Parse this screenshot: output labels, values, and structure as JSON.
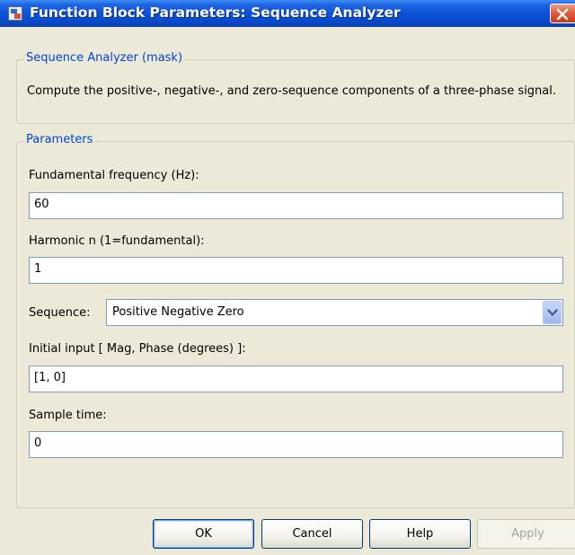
{
  "window": {
    "title": "Function Block Parameters: Sequence Analyzer"
  },
  "mask_group": {
    "legend": "Sequence Analyzer (mask)",
    "description": "Compute the positive-, negative-, and zero-sequence components of a three-phase signal."
  },
  "params_group": {
    "legend": "Parameters",
    "fundamental_frequency": {
      "label": "Fundamental frequency (Hz):",
      "value": "60"
    },
    "harmonic": {
      "label": "Harmonic n (1=fundamental):",
      "value": "1"
    },
    "sequence": {
      "label": "Sequence:",
      "selected": "Positive Negative Zero"
    },
    "initial_input": {
      "label": "Initial input [ Mag, Phase (degrees) ]:",
      "value": "[1, 0]"
    },
    "sample_time": {
      "label": "Sample time:",
      "value": "0"
    }
  },
  "buttons": {
    "ok": "OK",
    "cancel": "Cancel",
    "help": "Help",
    "apply": "Apply"
  },
  "colors": {
    "titlebar": "#0a52d8",
    "legend_text": "#0046d5",
    "dialog_bg": "#ece9d8",
    "close_button": "#e35d3b"
  },
  "icons": {
    "title": "simulink-block-icon",
    "close": "close-icon",
    "dropdown": "chevron-down-icon"
  }
}
